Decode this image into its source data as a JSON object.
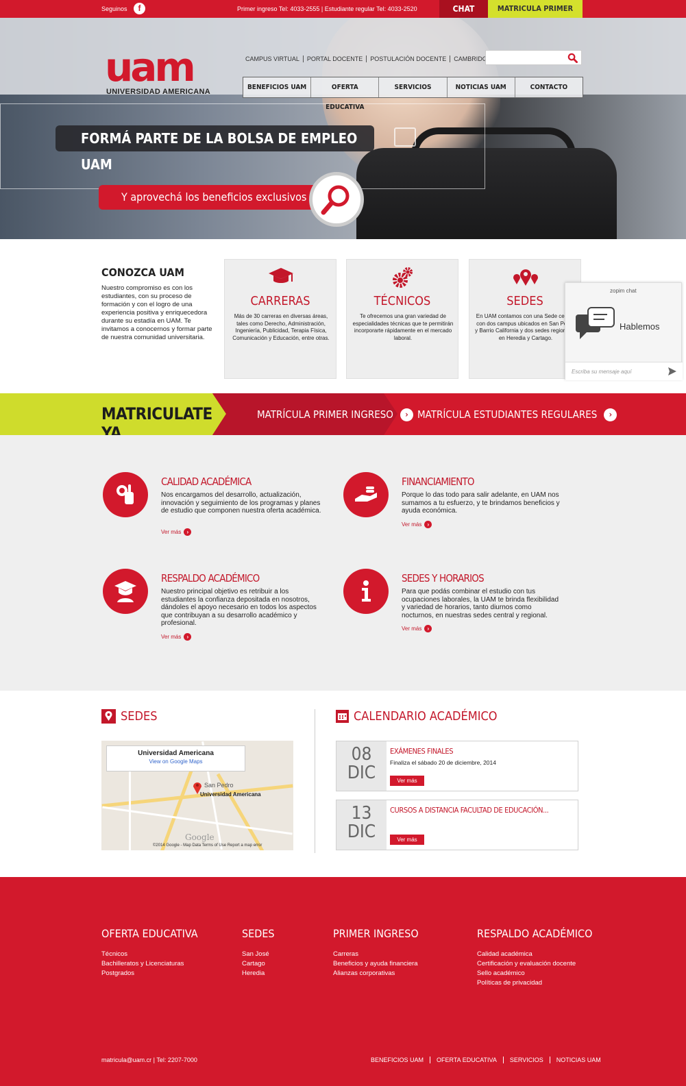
{
  "topbar": {
    "follow_label": "Seguinos",
    "phones": "Primer ingreso Tel: 4033-2555 | Estudiante regular Tel: 4033-2520",
    "chat": "CHAT",
    "enroll_first": "MATRICULA PRIMER INGRESO"
  },
  "header": {
    "logo_mark": "uam",
    "logo_name": "UNIVERSIDAD AMERICANA",
    "toplinks": [
      "CAMPUS VIRTUAL",
      "PORTAL DOCENTE",
      "POSTULACIÓN DOCENTE",
      "CAMBRIDGE LMS"
    ],
    "search_placeholder": "",
    "nav": [
      "BENEFICIOS UAM",
      "OFERTA EDUCATIVA",
      "SERVICIOS",
      "NOTICIAS UAM",
      "CONTACTO"
    ]
  },
  "hero": {
    "headline": "FORMÁ PARTE DE LA BOLSA  DE EMPLEO UAM",
    "subline": "Y aprovechá los beneficios exclusivos"
  },
  "conozca": {
    "title": "CONOZCA UAM",
    "text": "Nuestro compromiso es con los estudiantes, con su proceso de formación y con el logro de una experiencia positiva y enriquecedora durante su estadía en UAM. Te invitamos a conocernos y formar parte de nuestra comunidad universitaria."
  },
  "cards": [
    {
      "title": "CARRERAS",
      "text": "Más de 30 carreras en diversas áreas, tales como Derecho, Administración, Ingeniería, Publicidad, Terapia Física, Comunicación y Educación, entre otras.",
      "icon": "graduation-cap-icon"
    },
    {
      "title": "TÉCNICOS",
      "text": "Te ofrecemos una gran variedad de especialidades técnicas que te permitirán incorporarte rápidamente en el mercado laboral.",
      "icon": "gears-icon"
    },
    {
      "title": "SEDES",
      "text": "En UAM contamos con una Sede central con dos campus ubicados en San Pedro y Barrio California y dos sedes regionales en Heredia y Cartago.",
      "icon": "location-pins-icon"
    }
  ],
  "zopim": {
    "header": "zopim chat",
    "talk": "Hablemos",
    "input_placeholder": "Escriba su mensaje aquí"
  },
  "matriculate": {
    "title": "MATRICULATE YA",
    "first": "MATRÍCULA PRIMER INGRESO",
    "regular": "MATRÍCULA ESTUDIANTES REGULARES"
  },
  "features": [
    {
      "title": "CALIDAD ACADÉMICA",
      "text": "Nos encargamos del desarrollo, actualización, innovación y seguimiento de los programas y planes de estudio que componen nuestra oferta académica.",
      "more": "Ver más",
      "icon": "ok-hand-icon"
    },
    {
      "title": "FINANCIAMIENTO",
      "text": "Porque lo das todo para salir adelante, en UAM nos sumamos a tu esfuerzo, y te brindamos beneficios y ayuda económica.",
      "more": "Ver más",
      "icon": "hand-coins-icon"
    },
    {
      "title": "RESPALDO ACADÉMICO",
      "text": "Nuestro principal objetivo es retribuir a los estudiantes la confianza depositada en nosotros, dándoles el apoyo necesario en todos los aspectos que contribuyan a su desarrollo académico y profesional.",
      "more": "Ver más",
      "icon": "graduate-icon"
    },
    {
      "title": "SEDES Y HORARIOS",
      "text": "Para que podás combinar el estudio con tus ocupaciones laborales, la UAM te brinda flexibilidad y variedad de horarios, tanto diurnos como nocturnos, en nuestras sedes central y regional.",
      "more": "Ver más",
      "icon": "info-icon"
    }
  ],
  "sedes": {
    "title": "SEDES",
    "map_place": "Universidad Americana",
    "map_link": "View on Google Maps",
    "map_area": "San Pedro",
    "map_footer": "©2014 Google - Map Data   Terms of Use   Report a map error",
    "map_brand": "Google"
  },
  "calendar": {
    "title": "CALENDARIO ACADÉMICO",
    "events": [
      {
        "day": "08",
        "month": "DIC",
        "title": "EXÁMENES FINALES",
        "detail": "Finaliza el sábado 20 de diciembre, 2014",
        "more": "Ver más"
      },
      {
        "day": "13",
        "month": "DIC",
        "title": "CURSOS A DISTANCIA FACULTAD DE EDUCACIÓN...",
        "detail": "",
        "more": "Ver más"
      }
    ]
  },
  "footer": {
    "columns": [
      {
        "title": "OFERTA EDUCATIVA",
        "items": [
          "Técnicos",
          "Bachilleratos y Licenciaturas",
          "Postgrados"
        ]
      },
      {
        "title": "SEDES",
        "items": [
          "San José",
          "Cartago",
          "Heredia"
        ]
      },
      {
        "title": "PRIMER INGRESO",
        "items": [
          "Carreras",
          "Beneficios y ayuda financiera",
          "Alianzas corporativas"
        ]
      },
      {
        "title": "RESPALDO ACADÉMICO",
        "items": [
          "Calidad académica",
          "Certificación y evaluación docente",
          "Sello académico",
          "Políticas de privacidad"
        ]
      }
    ],
    "contact": "matricula@uam.cr | Tel: 2207-7000",
    "links": [
      "BENEFICIOS UAM",
      "OFERTA EDUCATIVA",
      "SERVICIOS",
      "NOTICIAS UAM"
    ]
  },
  "colors": {
    "brand": "#d2192c",
    "accent_lime": "#cfdc2c",
    "dark_red": "#a9101f"
  }
}
